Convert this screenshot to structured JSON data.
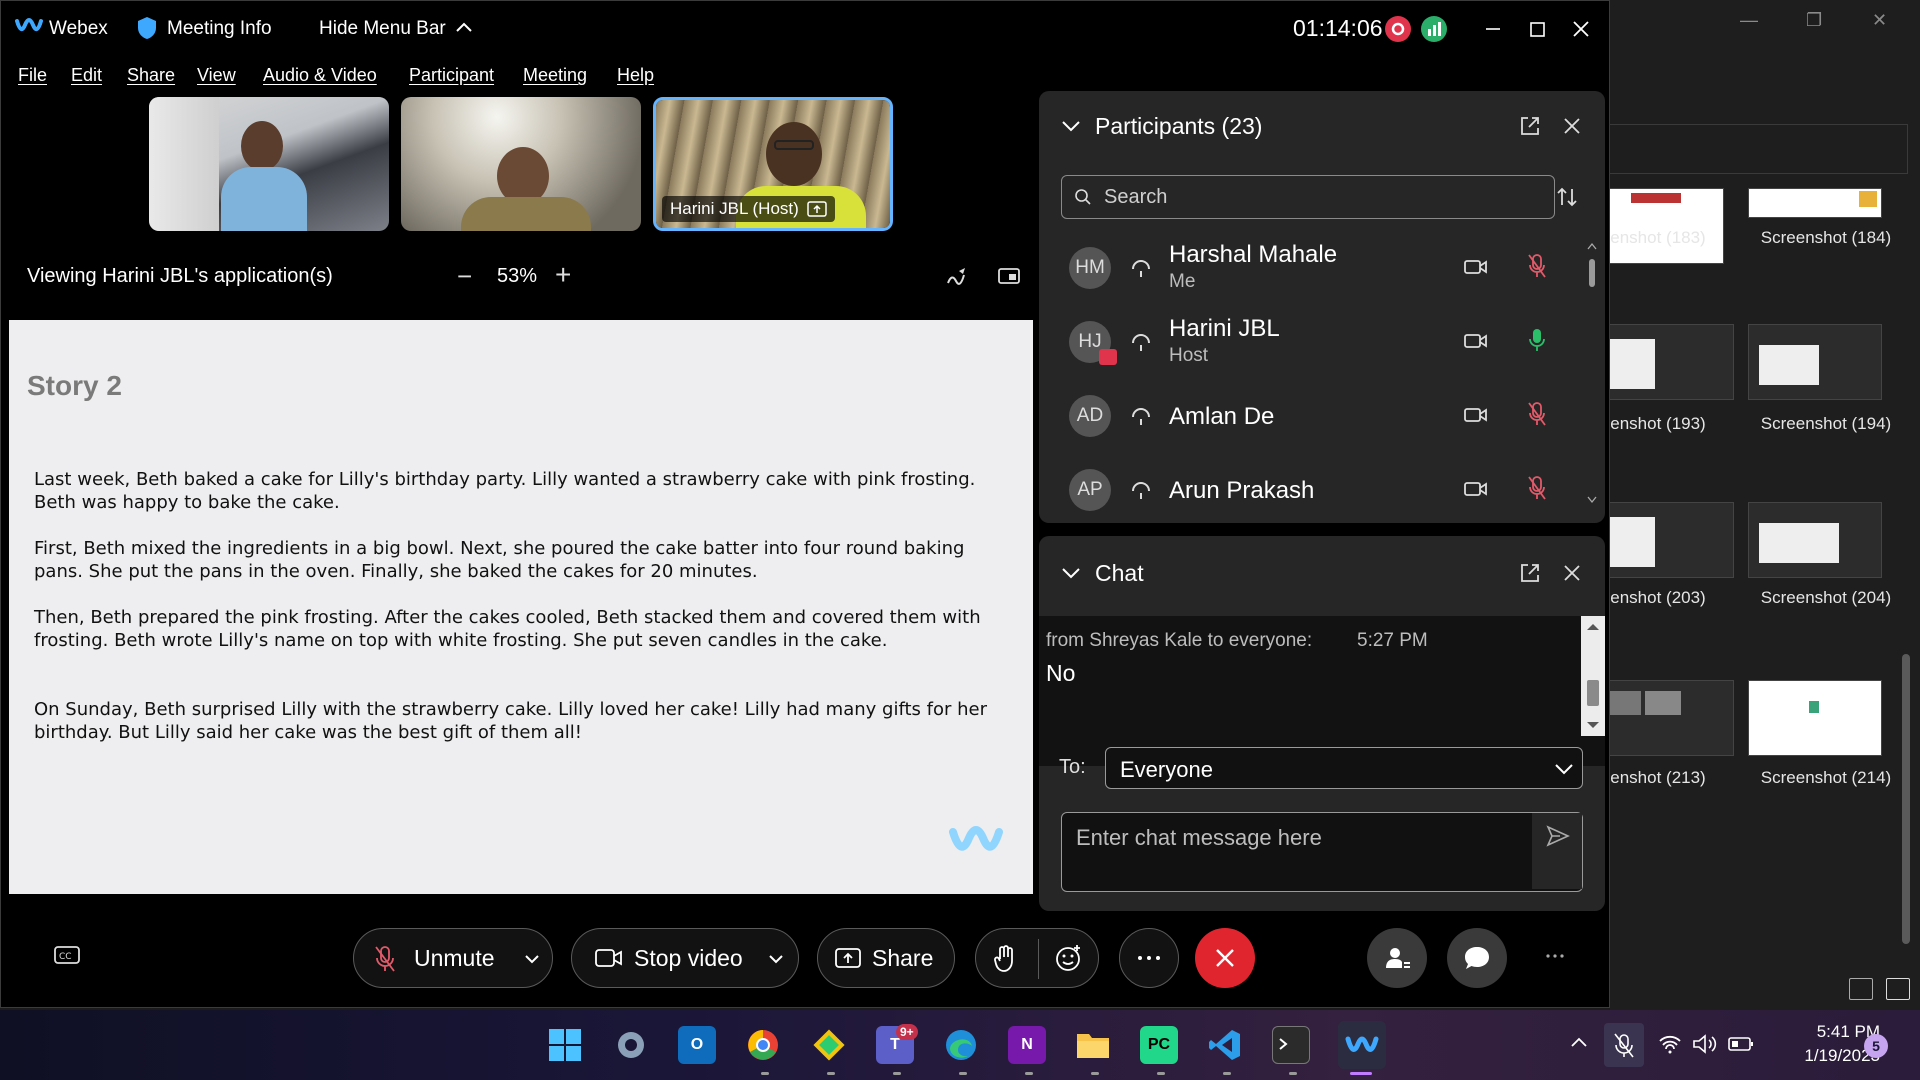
{
  "window": {
    "app_name": "Webex",
    "meeting_info": "Meeting Info",
    "hide_menu_bar": "Hide Menu Bar",
    "timer": "01:14:06"
  },
  "menu": [
    "File",
    "Edit",
    "Share",
    "View",
    "Audio & Video",
    "Participant",
    "Meeting",
    "Help"
  ],
  "videos": [
    {
      "name": ""
    },
    {
      "name": ""
    },
    {
      "name": "Harini JBL (Host)"
    }
  ],
  "viewing": {
    "label": "Viewing Harini JBL's application(s)",
    "zoom_out": "−",
    "zoom": "53%",
    "zoom_in": "+"
  },
  "shared_doc": {
    "title": "Story 2",
    "paragraphs": [
      "Last week, Beth baked a cake for Lilly's birthday party. Lilly wanted a strawberry cake with pink frosting. Beth was happy to bake the cake.",
      "First, Beth mixed the ingredients in a big bowl. Next, she poured the cake batter into four round baking pans. She put the pans in the oven. Finally, she baked the cakes for 20 minutes.",
      "Then, Beth prepared the pink frosting. After the cakes cooled, Beth stacked them and covered them with frosting. Beth wrote Lilly's name on top with white frosting. She put seven candles in the cake.",
      "On Sunday, Beth surprised Lilly with the strawberry cake. Lilly loved her cake! Lilly had many gifts for her birthday. But Lilly said her cake was the best gift of them all!"
    ]
  },
  "participants": {
    "title": "Participants (23)",
    "search_placeholder": "Search",
    "list": [
      {
        "initials": "HM",
        "name": "Harshal Mahale",
        "role": "Me",
        "mic": "muted"
      },
      {
        "initials": "HJ",
        "name": "Harini JBL",
        "role": "Host",
        "mic": "active"
      },
      {
        "initials": "AD",
        "name": "Amlan De",
        "role": "",
        "mic": "muted"
      },
      {
        "initials": "AP",
        "name": "Arun Prakash",
        "role": "",
        "mic": "muted"
      }
    ]
  },
  "chat": {
    "title": "Chat",
    "messages": [
      {
        "from": "from Shreyas Kale to everyone:",
        "time": "5:27 PM",
        "text": "No"
      }
    ],
    "to_label": "To:",
    "to_value": "Everyone",
    "input_placeholder": "Enter chat message here"
  },
  "controls": {
    "unmute": "Unmute",
    "stop_video": "Stop video",
    "share": "Share"
  },
  "explorer": {
    "thumbnails": [
      {
        "label": "enshot (183)"
      },
      {
        "label": "Screenshot (184)"
      },
      {
        "label": "enshot (193)"
      },
      {
        "label": "Screenshot (194)"
      },
      {
        "label": "enshot (203)"
      },
      {
        "label": "Screenshot (204)"
      },
      {
        "label": "enshot (213)"
      },
      {
        "label": "Screenshot (214)"
      }
    ]
  },
  "taskbar": {
    "time": "5:41 PM",
    "date": "1/19/2023",
    "teams_badge": "9+",
    "notification_count": "5",
    "apps": [
      "start",
      "settings",
      "outlook",
      "chrome",
      "git",
      "teams",
      "edge",
      "onenote",
      "file-explorer",
      "pycharm",
      "vscode",
      "terminal",
      "webex"
    ]
  },
  "colors": {
    "accent_blue": "#64b4ff",
    "record_red": "#e0334c",
    "end_red": "#e0252f",
    "mic_muted": "#e35a6a",
    "mic_active": "#2bbf6a"
  }
}
